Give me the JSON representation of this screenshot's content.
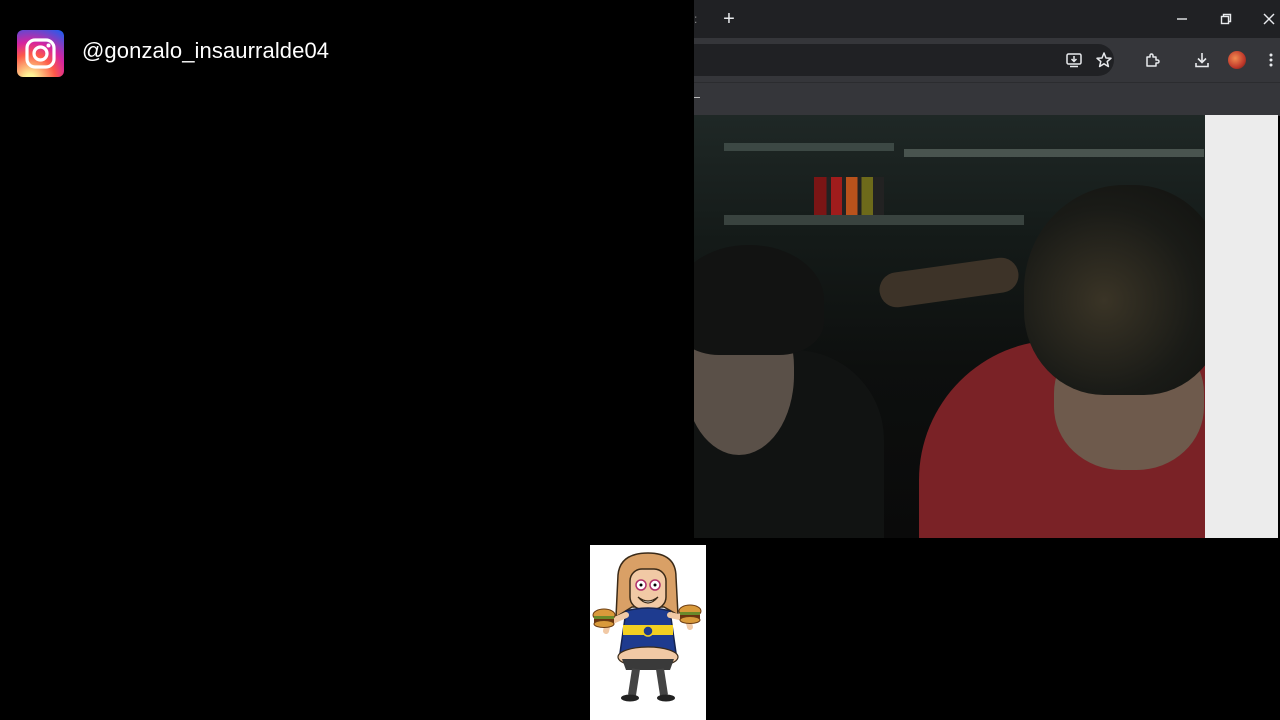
{
  "overlay": {
    "instagram_handle": "@gonzalo_insaurralde04",
    "icon": "instagram-icon"
  },
  "browser": {
    "tabstrip": {
      "new_tab_label": "+",
      "window_controls": [
        "minimize-icon",
        "restore-icon",
        "close-icon"
      ]
    },
    "toolbar": {
      "icons": [
        "install-app-icon",
        "bookmark-star-icon",
        "extensions-icon",
        "download-icon",
        "profile-avatar",
        "menu-icon"
      ]
    }
  },
  "colors": {
    "tabstrip_bg": "#202124",
    "toolbar_bg": "#35363a",
    "omnibox_bg": "#202124",
    "icon_color": "#e8eaed",
    "page_bg": "#000000"
  }
}
